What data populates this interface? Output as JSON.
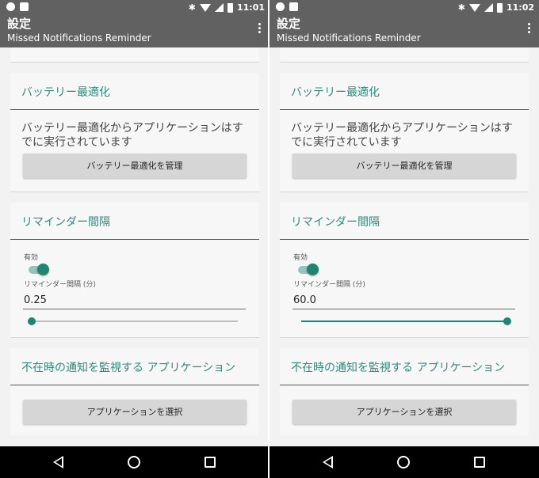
{
  "screens": [
    {
      "status_time": "11:01",
      "app_title": "設定",
      "app_subtitle": "Missed Notifications Reminder",
      "battery_section_title": "バッテリー最適化",
      "battery_text": "バッテリー最適化からアプリケーションはすでに実行されています",
      "battery_button": "バッテリー最適化を管理",
      "reminder_section_title": "リマインダー間隔",
      "enabled_label": "有効",
      "enabled": true,
      "interval_label": "リマインダー間隔 (分)",
      "interval_value": "0.25",
      "slider_fraction": 0.0,
      "apps_section_title": "不在時の通知を監視する アプリケーション",
      "apps_button": "アプリケーションを選択"
    },
    {
      "status_time": "11:02",
      "app_title": "設定",
      "app_subtitle": "Missed Notifications Reminder",
      "battery_section_title": "バッテリー最適化",
      "battery_text": "バッテリー最適化からアプリケーションはすでに実行されています",
      "battery_button": "バッテリー最適化を管理",
      "reminder_section_title": "リマインダー間隔",
      "enabled_label": "有効",
      "enabled": true,
      "interval_label": "リマインダー間隔 (分)",
      "interval_value": "60.0",
      "slider_fraction": 1.0,
      "apps_section_title": "不在時の通知を監視する アプリケーション",
      "apps_button": "アプリケーションを選択"
    }
  ],
  "colors": {
    "accent": "#2e8b7a",
    "toolbar": "#616161",
    "toggle_thumb": "#1e8570",
    "toggle_track": "#93c4bb"
  },
  "icons": {
    "status_left": [
      "notification-icon",
      "image-icon"
    ],
    "status_right": [
      "bluetooth-icon",
      "wifi-icon",
      "signal-icon",
      "battery-icon"
    ],
    "appbar": "more-vert-icon",
    "navbar": [
      "back-icon",
      "home-icon",
      "recents-icon"
    ]
  }
}
